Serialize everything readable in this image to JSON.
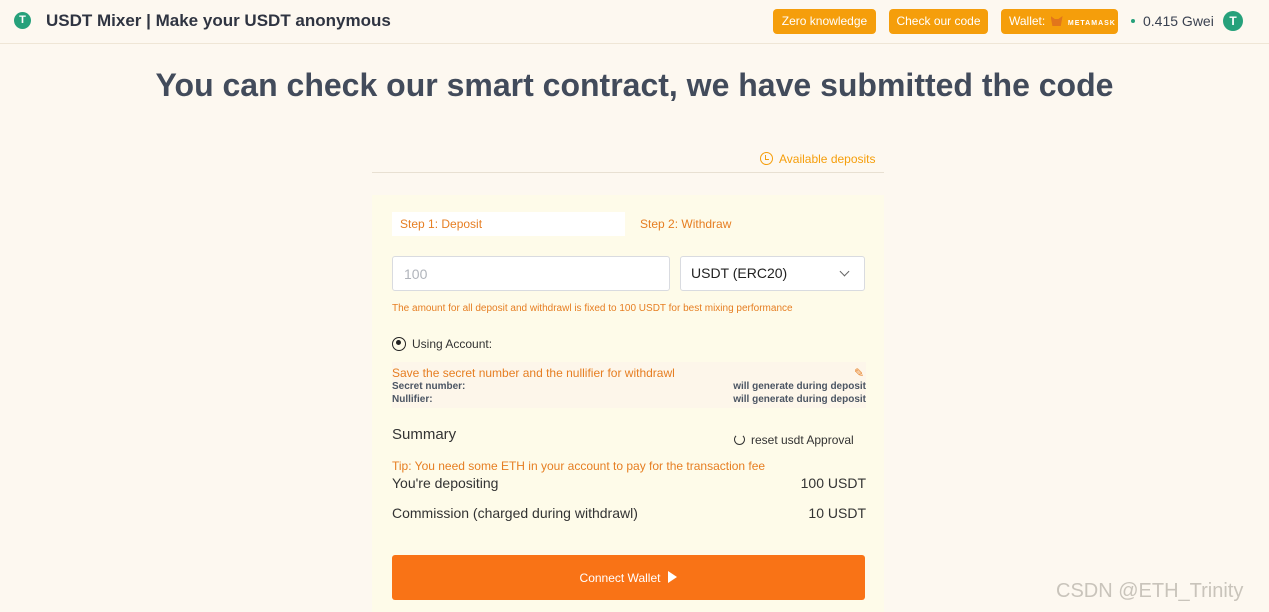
{
  "header": {
    "logo_glyph": "T",
    "title": "USDT Mixer | Make your USDT anonymous",
    "buttons": {
      "zero_knowledge": "Zero knowledge",
      "check_code": "Check our code",
      "wallet_label": "Wallet:",
      "wallet_brand": "METAMASK"
    },
    "gas_price": "0.415 Gwei",
    "network_icon_glyph": "T"
  },
  "headline": "You can check our smart contract, we have submitted the code",
  "available_deposits": "Available deposits",
  "tabs": {
    "deposit": "Step 1: Deposit",
    "withdraw": "Step 2: Withdraw"
  },
  "form": {
    "amount_placeholder": "100",
    "token": "USDT (ERC20)",
    "note": "The amount for all deposit and withdrawl is fixed to 100 USDT for best mixing performance",
    "using_account": "Using Account:"
  },
  "secret": {
    "save_text": "Save the secret number and the nullifier for withdrawl",
    "secret_label": "Secret number:",
    "secret_value": "will generate during deposit",
    "nullifier_label": "Nullifier:",
    "nullifier_value": "will generate during deposit"
  },
  "summary": {
    "title": "Summary",
    "reset": "reset usdt Approval",
    "tip": "Tip: You need some ETH in your account to pay for the transaction fee",
    "depositing_label": "You're depositing",
    "depositing_value": "100 USDT",
    "commission_label": "Commission (charged during withdrawl)",
    "commission_value": "10 USDT"
  },
  "connect_button": "Connect Wallet",
  "watermark": "CSDN @ETH_Trinity",
  "colors": {
    "accent": "#f59e0b",
    "primary_button": "#f97316",
    "tether_green": "#26a17b"
  }
}
